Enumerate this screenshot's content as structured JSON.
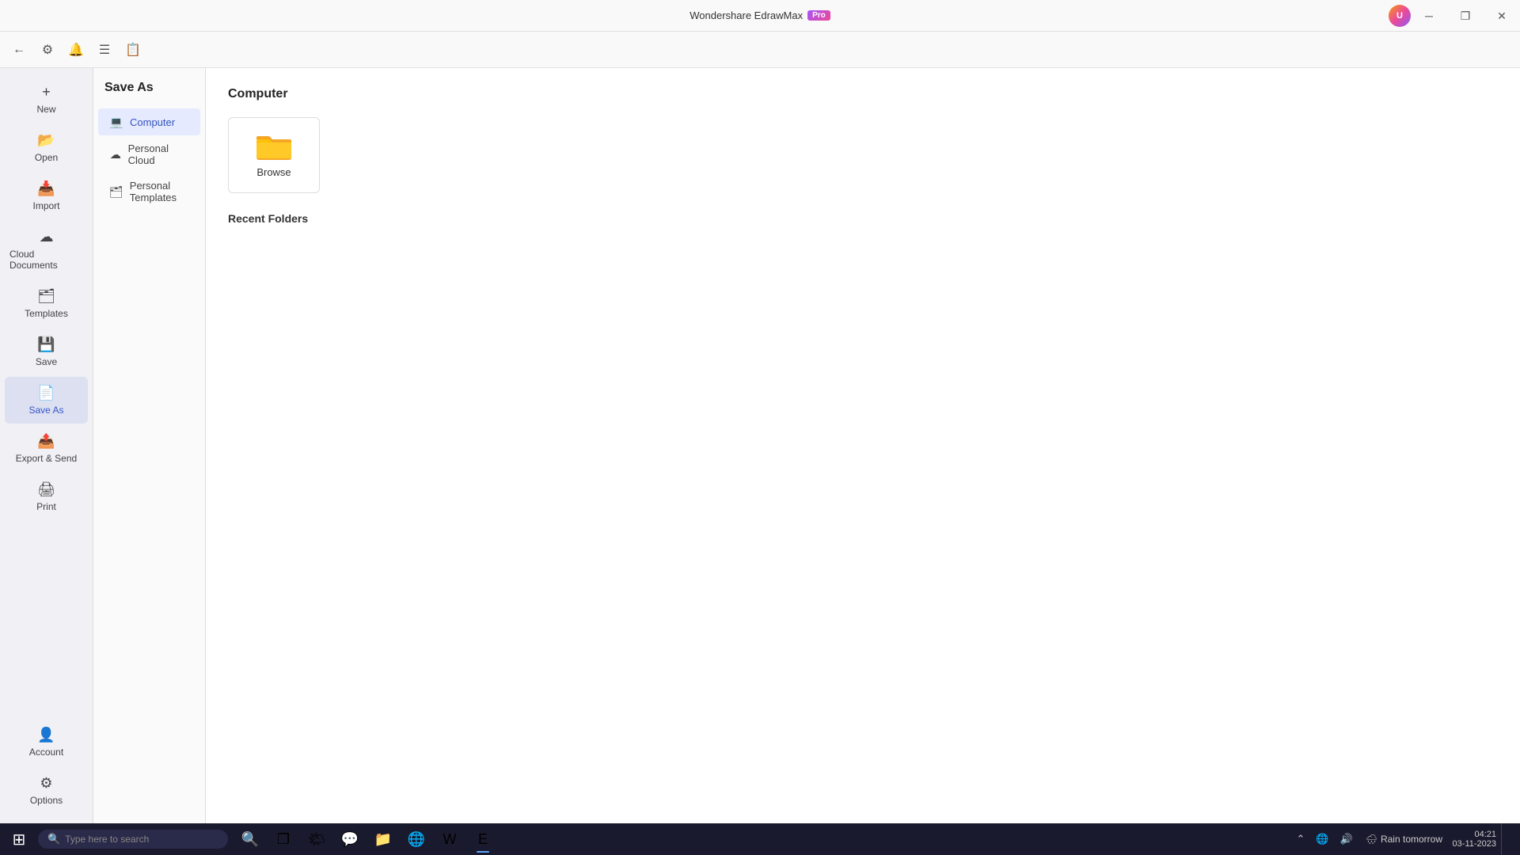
{
  "titlebar": {
    "app_name": "Wondershare EdrawMax",
    "pro_label": "Pro",
    "minimize_icon": "─",
    "restore_icon": "❐",
    "close_icon": "✕"
  },
  "toolbar": {
    "icons": [
      "←",
      "⚙",
      "🔔",
      "☰",
      "📋"
    ]
  },
  "left_sidebar": {
    "items": [
      {
        "id": "new",
        "label": "New",
        "icon": "+"
      },
      {
        "id": "open",
        "label": "Open",
        "icon": "📂"
      },
      {
        "id": "import",
        "label": "Import",
        "icon": "📥"
      },
      {
        "id": "cloud-documents",
        "label": "Cloud Documents",
        "icon": "☁"
      },
      {
        "id": "templates",
        "label": "Templates",
        "icon": "🗂"
      },
      {
        "id": "save",
        "label": "Save",
        "icon": "💾"
      },
      {
        "id": "save-as",
        "label": "Save As",
        "icon": "📄",
        "active": true
      },
      {
        "id": "export-send",
        "label": "Export & Send",
        "icon": "📤"
      },
      {
        "id": "print",
        "label": "Print",
        "icon": "🖨"
      }
    ],
    "bottom_items": [
      {
        "id": "account",
        "label": "Account",
        "icon": "👤"
      },
      {
        "id": "options",
        "label": "Options",
        "icon": "⚙"
      }
    ]
  },
  "middle_panel": {
    "title": "Save As",
    "items": [
      {
        "id": "computer",
        "label": "Computer",
        "icon": "💻",
        "active": true
      },
      {
        "id": "personal-cloud",
        "label": "Personal Cloud",
        "icon": "☁"
      },
      {
        "id": "personal-templates",
        "label": "Personal Templates",
        "icon": "🗂"
      }
    ]
  },
  "main_content": {
    "title": "Computer",
    "browse_label": "Browse",
    "recent_folders_label": "Recent Folders"
  },
  "taskbar": {
    "start_icon": "⊞",
    "search_placeholder": "Type here to search",
    "apps": [
      {
        "id": "search",
        "icon": "🔍"
      },
      {
        "id": "task-view",
        "icon": "❐"
      },
      {
        "id": "widgets",
        "icon": "🌤"
      },
      {
        "id": "chat",
        "icon": "💬"
      },
      {
        "id": "explorer",
        "icon": "📁"
      },
      {
        "id": "edge",
        "icon": "🌐"
      },
      {
        "id": "word",
        "icon": "W"
      },
      {
        "id": "edraw",
        "icon": "E",
        "active": true
      }
    ],
    "system": {
      "weather_icon": "🌧",
      "weather_text": "Rain tomorrow",
      "time": "04:21",
      "date": "03-11-2023"
    }
  }
}
